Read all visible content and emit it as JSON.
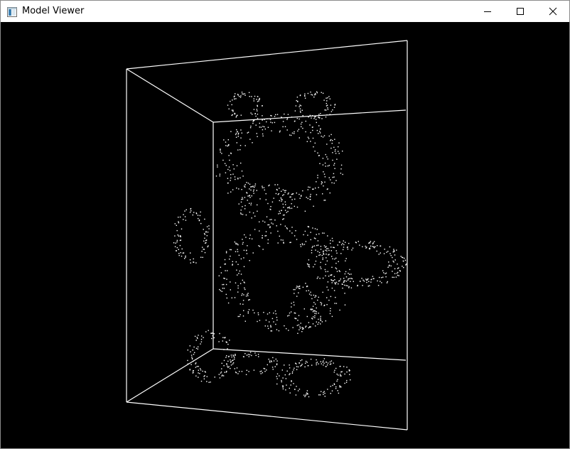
{
  "window": {
    "title": "Model Viewer",
    "icon": "app-window-icon"
  },
  "titlebar_buttons": [
    {
      "name": "minimize",
      "icon": "minimize-icon"
    },
    {
      "name": "maximize",
      "icon": "maximize-icon"
    },
    {
      "name": "close",
      "icon": "close-icon"
    }
  ],
  "viewport": {
    "content": "point-cloud-teddy-bear",
    "background_color": "#000000",
    "wireframe_color": "#ffffff",
    "point_color": "#ffffff"
  }
}
